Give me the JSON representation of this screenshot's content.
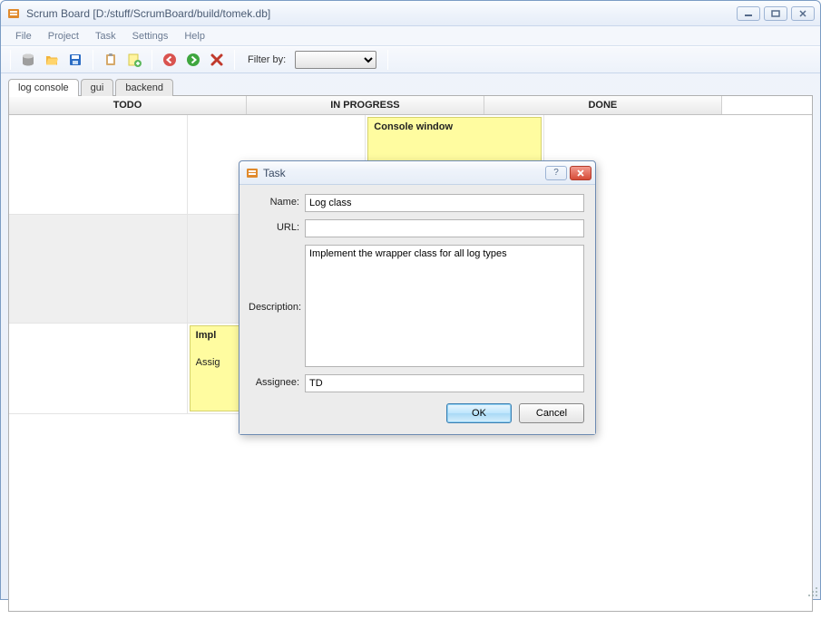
{
  "app": {
    "title": "Scrum Board [D:/stuff/ScrumBoard/build/tomek.db]"
  },
  "menu": {
    "file": "File",
    "project": "Project",
    "task": "Task",
    "settings": "Settings",
    "help": "Help"
  },
  "toolbar": {
    "filter_label": "Filter by:"
  },
  "tabs": {
    "log_console": "log console",
    "gui": "gui",
    "backend": "backend"
  },
  "columns": {
    "todo": "TODO",
    "in_progress": "IN PROGRESS",
    "done": "DONE"
  },
  "cards": {
    "done1": {
      "title": "Console window"
    },
    "prog1": {
      "title": "Impl",
      "assignee": "Assig"
    }
  },
  "dialog": {
    "title": "Task",
    "labels": {
      "name": "Name:",
      "url": "URL:",
      "description": "Description:",
      "assignee": "Assignee:"
    },
    "values": {
      "name": "Log class",
      "url": "",
      "description": "Implement the wrapper class for all log types",
      "assignee": "TD"
    },
    "buttons": {
      "ok": "OK",
      "cancel": "Cancel"
    }
  }
}
